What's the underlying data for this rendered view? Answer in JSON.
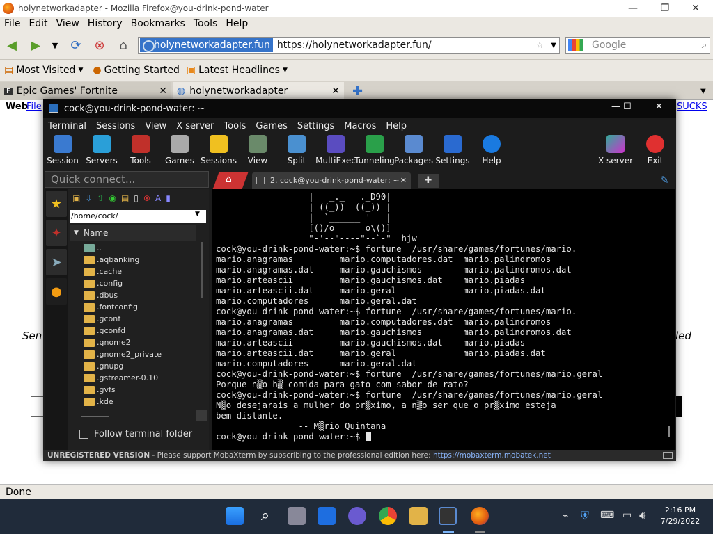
{
  "firefox": {
    "title": "holynetworkadapter - Mozilla Firefox@you-drink-pond-water",
    "menu": [
      "File",
      "Edit",
      "View",
      "History",
      "Bookmarks",
      "Tools",
      "Help"
    ],
    "url_site": "holynetworkadapter.fun",
    "url": "https://holynetworkadapter.fun/",
    "search_placeholder": "Google",
    "bookmarks": [
      "Most Visited",
      "Getting Started",
      "Latest Headlines"
    ],
    "tabs": [
      "Epic Games' Fortnite",
      "holynetworkadapter"
    ],
    "page_left": "Web",
    "page_link": "File",
    "page_right": "SUCKS",
    "page_side_left": "Sen",
    "page_side_right": "led",
    "status": "Done"
  },
  "moba": {
    "title": "cock@you-drink-pond-water: ~",
    "menu": [
      "Terminal",
      "Sessions",
      "View",
      "X server",
      "Tools",
      "Games",
      "Settings",
      "Macros",
      "Help"
    ],
    "tools": [
      "Session",
      "Servers",
      "Tools",
      "Games",
      "Sessions",
      "View",
      "Split",
      "MultiExec",
      "Tunneling",
      "Packages",
      "Settings",
      "Help"
    ],
    "xserver": "X server",
    "exit": "Exit",
    "quick_connect": "Quick connect...",
    "path": "/home/cock/",
    "name_header": "Name",
    "files": [
      "..",
      ".aqbanking",
      ".cache",
      ".config",
      ".dbus",
      ".fontconfig",
      ".gconf",
      ".gconfd",
      ".gnome2",
      ".gnome2_private",
      ".gnupg",
      ".gstreamer-0.10",
      ".gvfs",
      ".kde"
    ],
    "follow": "Follow terminal folder",
    "session_tab": "2. cock@you-drink-pond-water: ~",
    "terminal_lines": [
      "                  |   _._   ._D90|",
      "                  | ((_))  ((_)) |",
      "                  |  `______-'   |",
      "                  [()/o      o\\()]",
      "                  \"-'--\"----\"--`-\"  hjw",
      "cock@you-drink-pond-water:~$ fortune  /usr/share/games/fortunes/mario.",
      "mario.anagramas         mario.computadores.dat  mario.palindromos",
      "mario.anagramas.dat     mario.gauchismos        mario.palindromos.dat",
      "mario.arteascii         mario.gauchismos.dat    mario.piadas",
      "mario.arteascii.dat     mario.geral             mario.piadas.dat",
      "mario.computadores      mario.geral.dat",
      "cock@you-drink-pond-water:~$ fortune  /usr/share/games/fortunes/mario.",
      "mario.anagramas         mario.computadores.dat  mario.palindromos",
      "mario.anagramas.dat     mario.gauchismos        mario.palindromos.dat",
      "mario.arteascii         mario.gauchismos.dat    mario.piadas",
      "mario.arteascii.dat     mario.geral             mario.piadas.dat",
      "mario.computadores      mario.geral.dat",
      "cock@you-drink-pond-water:~$ fortune  /usr/share/games/fortunes/mario.geral",
      "Porque n▒o h▒ comida para gato com sabor de rato?",
      "cock@you-drink-pond-water:~$ fortune  /usr/share/games/fortunes/mario.geral",
      "N▒o desejarais a mulher do pr▒ximo, a n▒o ser que o pr▒ximo esteja",
      "bem distante.",
      "                -- M▒rio Quintana",
      "cock@you-drink-pond-water:~$ "
    ],
    "status_bold": "UNREGISTERED VERSION",
    "status_text": " -  Please support MobaXterm by subscribing to the professional edition here: ",
    "status_link": "https://mobaxterm.mobatek.net"
  },
  "taskbar": {
    "time": "2:16 PM",
    "date": "7/29/2022"
  }
}
